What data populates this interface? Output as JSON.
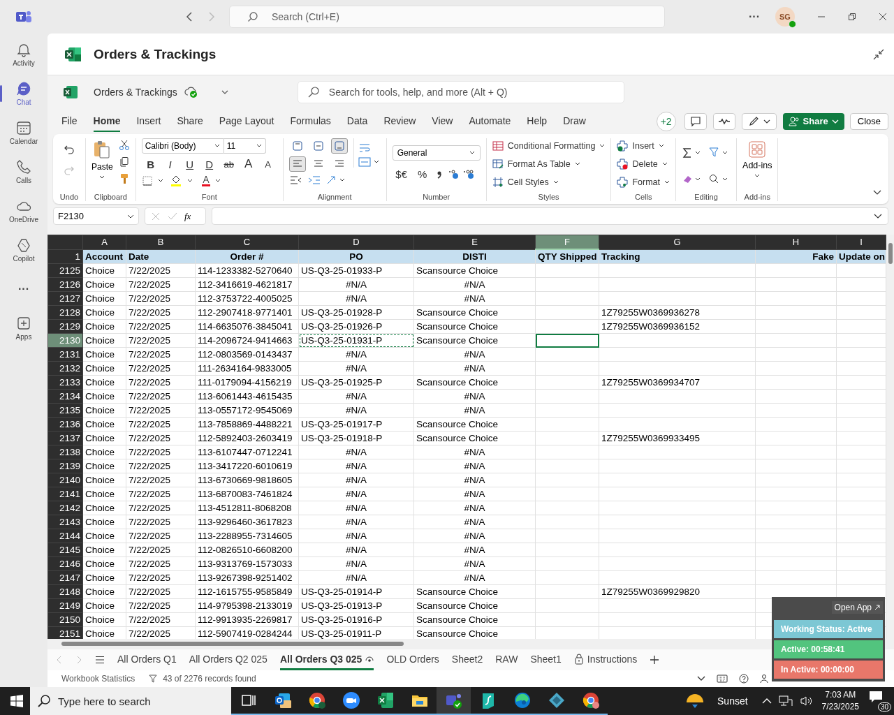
{
  "teams": {
    "search_placeholder": "Search (Ctrl+E)",
    "avatar": "SG",
    "more": "···"
  },
  "rail": [
    {
      "kind": "bell",
      "label": "Activity",
      "selected": false
    },
    {
      "kind": "chat",
      "label": "Chat",
      "selected": true
    },
    {
      "kind": "calendar",
      "label": "Calendar",
      "selected": false
    },
    {
      "kind": "phone",
      "label": "Calls",
      "selected": false
    },
    {
      "kind": "cloud",
      "label": "OneDrive",
      "selected": false
    },
    {
      "kind": "copilot",
      "label": "Copilot",
      "selected": false
    },
    {
      "kind": "more",
      "label": "···",
      "selected": false
    },
    {
      "kind": "apps",
      "label": "Apps",
      "selected": false
    }
  ],
  "app_title": "Orders & Trackings",
  "workbook": {
    "name": "Orders & Trackings",
    "search_placeholder": "Search for tools, help, and more (Alt + Q)",
    "collaborators": "+2",
    "share": "Share",
    "close": "Close"
  },
  "tabs": [
    {
      "label": "File",
      "selected": false
    },
    {
      "label": "Home",
      "selected": true
    },
    {
      "label": "Insert",
      "selected": false
    },
    {
      "label": "Share",
      "selected": false
    },
    {
      "label": "Page Layout",
      "selected": false
    },
    {
      "label": "Formulas",
      "selected": false
    },
    {
      "label": "Data",
      "selected": false
    },
    {
      "label": "Review",
      "selected": false
    },
    {
      "label": "View",
      "selected": false
    },
    {
      "label": "Automate",
      "selected": false
    },
    {
      "label": "Help",
      "selected": false
    },
    {
      "label": "Draw",
      "selected": false
    }
  ],
  "ribbon": {
    "undo": {
      "label": "Undo"
    },
    "clipboard": {
      "paste": "Paste",
      "label": "Clipboard"
    },
    "font": {
      "family": "Calibri (Body)",
      "size": "11",
      "styles": [
        "B",
        "I",
        "U",
        "D",
        "ab",
        "A",
        "A"
      ],
      "label": "Font"
    },
    "alignment": {
      "vertical_align": [
        {
          "kind": "top",
          "selected": false
        },
        {
          "kind": "middle",
          "selected": false
        },
        {
          "kind": "bottom",
          "selected": true
        }
      ],
      "horizontal_align": [
        {
          "kind": "left",
          "selected": true
        },
        {
          "kind": "center",
          "selected": false
        },
        {
          "kind": "right",
          "selected": false
        }
      ],
      "label": "Alignment"
    },
    "number": {
      "format": "General",
      "currency": "$€",
      "percent": "%",
      "label": "Number"
    },
    "styles": {
      "items": [
        "Conditional Formatting",
        "Format As Table",
        "Cell Styles"
      ],
      "label": "Styles"
    },
    "cells": {
      "items": [
        "Insert",
        "Delete",
        "Format"
      ],
      "label": "Cells"
    },
    "editing": {
      "label": "Editing"
    },
    "addins": {
      "button": "Add-ins",
      "label": "Add-ins"
    }
  },
  "formula_bar": {
    "name_box": "F2130",
    "fx": "fx"
  },
  "columns": [
    {
      "letter": "A",
      "heading": "Account",
      "selected": false
    },
    {
      "letter": "B",
      "heading": "Date",
      "selected": false
    },
    {
      "letter": "C",
      "heading": "Order #",
      "selected": false
    },
    {
      "letter": "D",
      "heading": "PO",
      "selected": false
    },
    {
      "letter": "E",
      "heading": "DISTI",
      "selected": false
    },
    {
      "letter": "F",
      "heading": "QTY Shipped",
      "selected": true
    },
    {
      "letter": "G",
      "heading": "Tracking",
      "selected": false
    },
    {
      "letter": "H",
      "heading": "Fake",
      "selected": false
    },
    {
      "letter": "I",
      "heading": "Update on",
      "selected": false
    }
  ],
  "header_row": "1",
  "rows": [
    {
      "row": "2125",
      "account": "Choice",
      "date": "7/22/2025",
      "order": "114-1233382-5270640",
      "po": "US-Q3-25-01933-P",
      "disti": "Scansource Choice",
      "found": true,
      "selected": false,
      "copied": false
    },
    {
      "row": "2126",
      "account": "Choice",
      "date": "7/22/2025",
      "order": "112-3416619-4621817",
      "po": "#N/A",
      "disti": "#N/A",
      "found": false,
      "selected": false,
      "copied": false
    },
    {
      "row": "2127",
      "account": "Choice",
      "date": "7/22/2025",
      "order": "112-3753722-4005025",
      "po": "#N/A",
      "disti": "#N/A",
      "found": false,
      "selected": false,
      "copied": false
    },
    {
      "row": "2128",
      "account": "Choice",
      "date": "7/22/2025",
      "order": "112-2907418-9771401",
      "po": "US-Q3-25-01928-P",
      "disti": "Scansource Choice",
      "tracking": "1Z79255W0369936278",
      "found": true,
      "selected": false,
      "copied": false
    },
    {
      "row": "2129",
      "account": "Choice",
      "date": "7/22/2025",
      "order": "114-6635076-3845041",
      "po": "US-Q3-25-01926-P",
      "disti": "Scansource Choice",
      "tracking": "1Z79255W0369936152",
      "found": true,
      "selected": false,
      "copied": false
    },
    {
      "row": "2130",
      "account": "Choice",
      "date": "7/22/2025",
      "order": "114-2096724-9414663",
      "po": "US-Q3-25-01931-P",
      "disti": "Scansource Choice",
      "found": true,
      "selected": true,
      "copied": true
    },
    {
      "row": "2131",
      "account": "Choice",
      "date": "7/22/2025",
      "order": "112-0803569-0143437",
      "po": "#N/A",
      "disti": "#N/A",
      "found": false,
      "selected": false,
      "copied": false
    },
    {
      "row": "2132",
      "account": "Choice",
      "date": "7/22/2025",
      "order": "111-2634164-9833005",
      "po": "#N/A",
      "disti": "#N/A",
      "found": false,
      "selected": false,
      "copied": false
    },
    {
      "row": "2133",
      "account": "Choice",
      "date": "7/22/2025",
      "order": "111-0179094-4156219",
      "po": "US-Q3-25-01925-P",
      "disti": "Scansource Choice",
      "tracking": "1Z79255W0369934707",
      "found": true,
      "selected": false,
      "copied": false
    },
    {
      "row": "2134",
      "account": "Choice",
      "date": "7/22/2025",
      "order": "113-6061443-4615435",
      "po": "#N/A",
      "disti": "#N/A",
      "found": false,
      "selected": false,
      "copied": false
    },
    {
      "row": "2135",
      "account": "Choice",
      "date": "7/22/2025",
      "order": "113-0557172-9545069",
      "po": "#N/A",
      "disti": "#N/A",
      "found": false,
      "selected": false,
      "copied": false
    },
    {
      "row": "2136",
      "account": "Choice",
      "date": "7/22/2025",
      "order": "113-7858869-4488221",
      "po": "US-Q3-25-01917-P",
      "disti": "Scansource Choice",
      "found": true,
      "selected": false,
      "copied": false
    },
    {
      "row": "2137",
      "account": "Choice",
      "date": "7/22/2025",
      "order": "112-5892403-2603419",
      "po": "US-Q3-25-01918-P",
      "disti": "Scansource Choice",
      "tracking": "1Z79255W0369933495",
      "found": true,
      "selected": false,
      "copied": false
    },
    {
      "row": "2138",
      "account": "Choice",
      "date": "7/22/2025",
      "order": "113-6107447-0712241",
      "po": "#N/A",
      "disti": "#N/A",
      "found": false,
      "selected": false,
      "copied": false
    },
    {
      "row": "2139",
      "account": "Choice",
      "date": "7/22/2025",
      "order": "113-3417220-6010619",
      "po": "#N/A",
      "disti": "#N/A",
      "found": false,
      "selected": false,
      "copied": false
    },
    {
      "row": "2140",
      "account": "Choice",
      "date": "7/22/2025",
      "order": "113-6730669-9818605",
      "po": "#N/A",
      "disti": "#N/A",
      "found": false,
      "selected": false,
      "copied": false
    },
    {
      "row": "2141",
      "account": "Choice",
      "date": "7/22/2025",
      "order": "113-6870083-7461824",
      "po": "#N/A",
      "disti": "#N/A",
      "found": false,
      "selected": false,
      "copied": false
    },
    {
      "row": "2142",
      "account": "Choice",
      "date": "7/22/2025",
      "order": "113-4512811-8068208",
      "po": "#N/A",
      "disti": "#N/A",
      "found": false,
      "selected": false,
      "copied": false
    },
    {
      "row": "2143",
      "account": "Choice",
      "date": "7/22/2025",
      "order": "113-9296460-3617823",
      "po": "#N/A",
      "disti": "#N/A",
      "found": false,
      "selected": false,
      "copied": false
    },
    {
      "row": "2144",
      "account": "Choice",
      "date": "7/22/2025",
      "order": "113-2288955-7314605",
      "po": "#N/A",
      "disti": "#N/A",
      "found": false,
      "selected": false,
      "copied": false
    },
    {
      "row": "2145",
      "account": "Choice",
      "date": "7/22/2025",
      "order": "112-0826510-6608200",
      "po": "#N/A",
      "disti": "#N/A",
      "found": false,
      "selected": false,
      "copied": false
    },
    {
      "row": "2146",
      "account": "Choice",
      "date": "7/22/2025",
      "order": "113-9313769-1573033",
      "po": "#N/A",
      "disti": "#N/A",
      "found": false,
      "selected": false,
      "copied": false
    },
    {
      "row": "2147",
      "account": "Choice",
      "date": "7/22/2025",
      "order": "113-9267398-9251402",
      "po": "#N/A",
      "disti": "#N/A",
      "found": false,
      "selected": false,
      "copied": false
    },
    {
      "row": "2148",
      "account": "Choice",
      "date": "7/22/2025",
      "order": "112-1615755-9585849",
      "po": "US-Q3-25-01914-P",
      "disti": "Scansource Choice",
      "tracking": "1Z79255W0369929820",
      "found": true,
      "selected": false,
      "copied": false
    },
    {
      "row": "2149",
      "account": "Choice",
      "date": "7/22/2025",
      "order": "114-9795398-2133019",
      "po": "US-Q3-25-01913-P",
      "disti": "Scansource Choice",
      "found": true,
      "selected": false,
      "copied": false
    },
    {
      "row": "2150",
      "account": "Choice",
      "date": "7/22/2025",
      "order": "112-9913935-2269817",
      "po": "US-Q3-25-01916-P",
      "disti": "Scansource Choice",
      "found": true,
      "selected": false,
      "copied": false
    },
    {
      "row": "2151",
      "account": "Choice",
      "date": "7/22/2025",
      "order": "112-5907419-0284244",
      "po": "US-Q3-25-01911-P",
      "disti": "Scansource Choice",
      "found": true,
      "selected": false,
      "copied": false
    }
  ],
  "sheet_tabs": [
    {
      "label": "All Orders Q1",
      "kind": "plain",
      "selected": false
    },
    {
      "label": "All Orders Q2 025",
      "kind": "plain",
      "selected": false
    },
    {
      "label": "All Orders Q3 025",
      "kind": "watched",
      "selected": true
    },
    {
      "label": "OLD Orders",
      "kind": "plain",
      "selected": false
    },
    {
      "label": "Sheet2",
      "kind": "plain",
      "selected": false
    },
    {
      "label": "RAW",
      "kind": "plain",
      "selected": false
    },
    {
      "label": "Sheet1",
      "kind": "plain",
      "selected": false
    },
    {
      "label": "Instructions",
      "kind": "locked",
      "selected": false
    }
  ],
  "status_bar": {
    "statistics": "Workbook Statistics",
    "filter": "43 of 2276 records found"
  },
  "widget": {
    "open_app": "Open App",
    "statuses": [
      {
        "label": "Working Status: Active",
        "color": "#7cc7d4"
      },
      {
        "label": "Active: 00:58:41",
        "color": "#52c47e"
      },
      {
        "label": "In Active: 00:00:00",
        "color": "#e8776a"
      }
    ]
  },
  "taskbar": {
    "search_placeholder": "Type here to search",
    "weather": "Sunset",
    "time": "7:03 AM",
    "date": "7/23/2025",
    "notifications": "30"
  }
}
